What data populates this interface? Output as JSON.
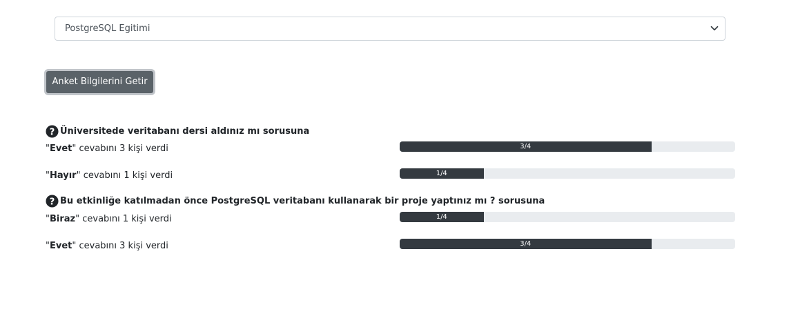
{
  "survey_select": {
    "selected": "PostgreSQL Egitimi"
  },
  "fetch_button": {
    "label": "Anket Bilgilerini Getir"
  },
  "questions": [
    {
      "text": "Üniversitede veritabanı dersi aldınız mı sorusuna",
      "answers": [
        {
          "quote_open": "\"",
          "option": "Evet",
          "quote_close": "\"",
          "suffix": " cevabını 3 kişi verdi",
          "progress_label": "3/4",
          "progress": 0.75
        },
        {
          "quote_open": "\"",
          "option": "Hayır",
          "quote_close": "\"",
          "suffix": " cevabını 1 kişi verdi",
          "progress_label": "1/4",
          "progress": 0.25
        }
      ]
    },
    {
      "text": "Bu etkinliğe katılmadan önce PostgreSQL veritabanı kullanarak bir proje yaptınız mı ? sorusuna",
      "answers": [
        {
          "quote_open": "\"",
          "option": "Biraz",
          "quote_close": "\"",
          "suffix": " cevabını 1 kişi verdi",
          "progress_label": "1/4",
          "progress": 0.25
        },
        {
          "quote_open": "\"",
          "option": "Evet",
          "quote_close": "\"",
          "suffix": " cevabını 3 kişi verdi",
          "progress_label": "3/4",
          "progress": 0.75
        }
      ]
    }
  ]
}
